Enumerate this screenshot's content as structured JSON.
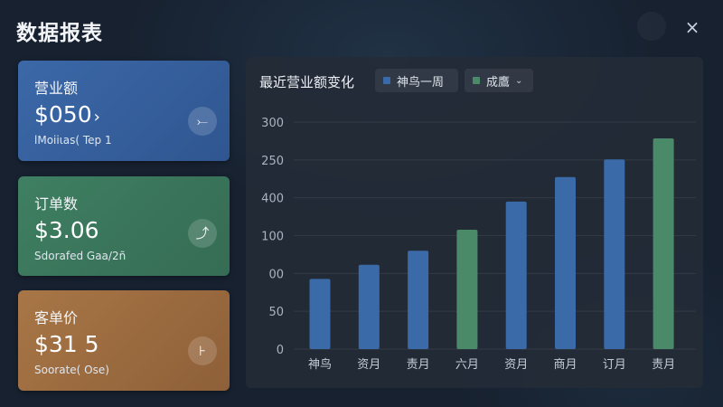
{
  "app": {
    "title": "数据报表",
    "close_glyph": "×"
  },
  "cards": [
    {
      "label": "营业额",
      "value": "$050",
      "value_suffix": "›",
      "subtitle": "lMoiiιas( Tep 1",
      "action_glyph": "⤚",
      "color": "#3c68a8"
    },
    {
      "label": "订单数",
      "value": "$3.06",
      "subtitle": "Sdorafed Gaa/2ñ",
      "action_glyph": "⤴",
      "color": "#3f7f62"
    },
    {
      "label": "客单价",
      "value": "$31 5",
      "subtitle": "Soorate( Ose)",
      "action_glyph": "⊦",
      "color": "#a87646"
    }
  ],
  "legend": [
    {
      "label": "神鸟一周",
      "color": "#3a6aa8"
    },
    {
      "label": "成鷹",
      "color": "#4a8a68",
      "dropdown": "⌄"
    }
  ],
  "chart_data": {
    "type": "bar",
    "title": "最近营业额变化",
    "categories": [
      "神鸟",
      "资月",
      "责月",
      "六月",
      "资月",
      "商月",
      "订月",
      "责月"
    ],
    "values": [
      100,
      120,
      140,
      170,
      210,
      245,
      270,
      300
    ],
    "series_index": [
      0,
      0,
      0,
      1,
      0,
      0,
      0,
      1
    ],
    "ytick_labels": [
      "300",
      "250",
      "400",
      "100",
      "00",
      "50",
      "0"
    ],
    "ylim": [
      0,
      300
    ],
    "grid": true
  }
}
